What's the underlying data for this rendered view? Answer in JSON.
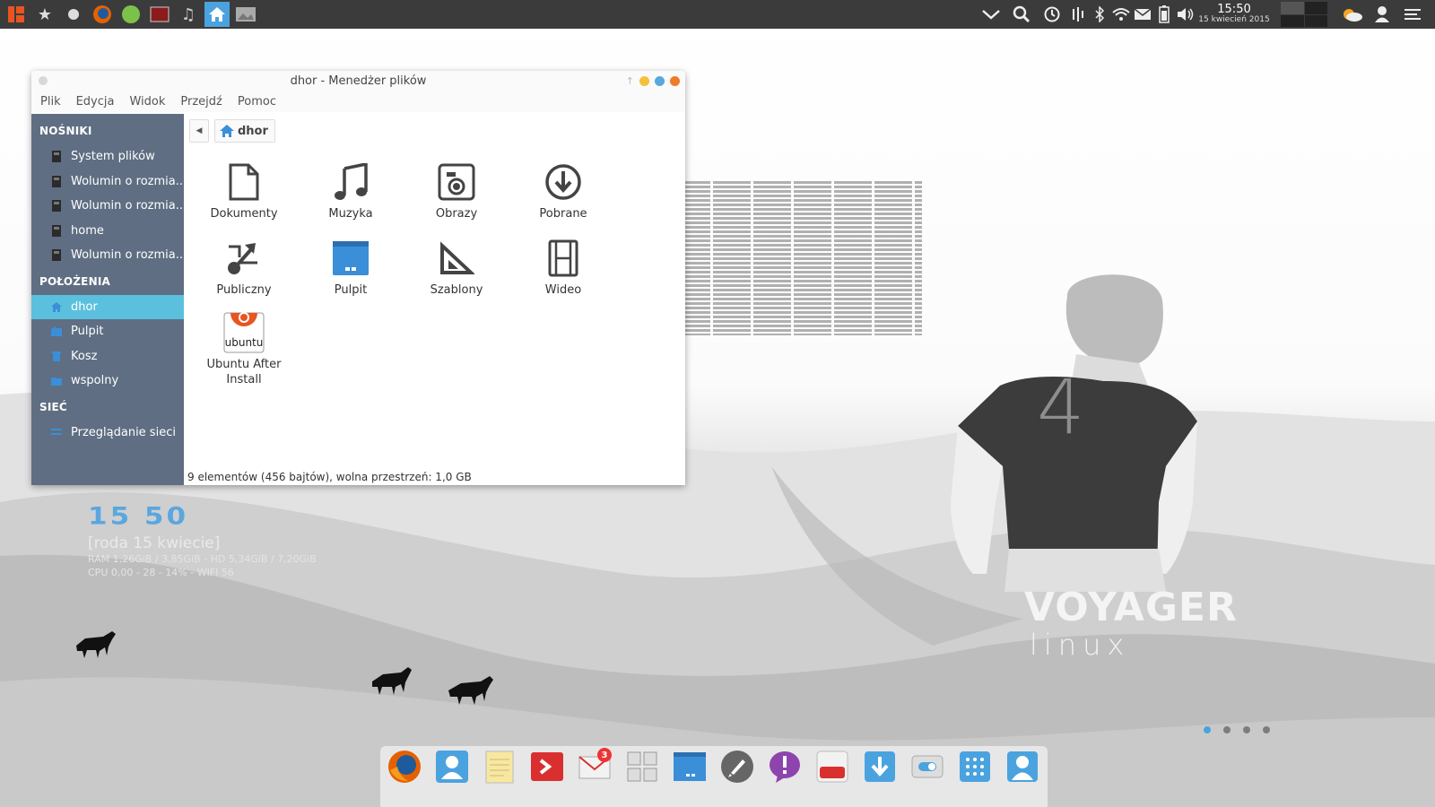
{
  "top_panel": {
    "launchers": [
      "ubuntu-logo-icon",
      "star-icon",
      "circle-icon",
      "firefox-icon",
      "green-orb-icon",
      "media-icon",
      "music-icon",
      "home-icon",
      "image-viewer-icon"
    ],
    "clock_time": "15:50",
    "clock_date": "15 kwiecień 2015"
  },
  "window": {
    "title": "dhor - Menedżer plików",
    "menu": [
      "Plik",
      "Edycja",
      "Widok",
      "Przejdź",
      "Pomoc"
    ],
    "sidebar": {
      "sections": [
        {
          "title": "NOŚNIKI",
          "items": [
            {
              "label": "System plików",
              "icon": "drive-icon"
            },
            {
              "label": "Wolumin o rozmia...",
              "icon": "drive-icon"
            },
            {
              "label": "Wolumin o rozmia...",
              "icon": "drive-icon"
            },
            {
              "label": "home",
              "icon": "drive-icon"
            },
            {
              "label": "Wolumin o rozmia...",
              "icon": "drive-icon"
            }
          ]
        },
        {
          "title": "POŁOŻENIA",
          "items": [
            {
              "label": "dhor",
              "icon": "home-icon",
              "selected": true
            },
            {
              "label": "Pulpit",
              "icon": "desktop-icon"
            },
            {
              "label": "Kosz",
              "icon": "trash-icon"
            },
            {
              "label": "wspolny",
              "icon": "folder-icon"
            }
          ]
        },
        {
          "title": "SIEĆ",
          "items": [
            {
              "label": "Przeglądanie sieci",
              "icon": "network-icon"
            }
          ]
        }
      ]
    },
    "path": {
      "current": "dhor"
    },
    "items": [
      {
        "label": "Dokumenty",
        "icon": "document-icon"
      },
      {
        "label": "Muzyka",
        "icon": "music-icon"
      },
      {
        "label": "Obrazy",
        "icon": "camera-icon"
      },
      {
        "label": "Pobrane",
        "icon": "download-icon"
      },
      {
        "label": "Publiczny",
        "icon": "share-icon"
      },
      {
        "label": "Pulpit",
        "icon": "desktop-folder-icon"
      },
      {
        "label": "Szablony",
        "icon": "template-icon"
      },
      {
        "label": "Wideo",
        "icon": "film-icon"
      },
      {
        "label": "Ubuntu After Install",
        "icon": "ubuntu-app-icon",
        "logo_text": "ubuntu"
      }
    ],
    "status": "9 elementów (456 bajtów), wolna przestrzeń: 1,0 GB"
  },
  "conky": {
    "time": "15 50",
    "date": "[roda 15 kwiecie]",
    "line1": "RAM 1,26GiB / 3,85GiB - HD 5,34GiB / 7,20GiB",
    "line2": "CPU 0,00 - 28 - 14% - WIFI 56"
  },
  "branding": {
    "line1": "VOYAGER",
    "line2": "linux",
    "shirt_number": "4"
  },
  "dock": {
    "items": [
      "firefox-icon",
      "contacts-icon",
      "notes-icon",
      "terminal-icon",
      "mail-icon",
      "tiles-icon",
      "desktop-icon",
      "rocket-icon",
      "chat-icon",
      "youtube-icon",
      "download-icon",
      "settings-toggle-icon",
      "app-grid-icon",
      "user-icon"
    ],
    "mail_badge": "3"
  },
  "colors": {
    "accent": "#5bc0de",
    "sidebar": "#5f6e82",
    "panel": "#3b3b3b",
    "win_yellow": "#f5c13a",
    "win_blue": "#5aa7e0",
    "win_orange": "#f07a2a"
  }
}
